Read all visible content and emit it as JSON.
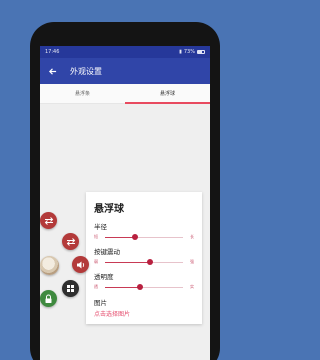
{
  "status": {
    "time": "17:46",
    "battery": "73%"
  },
  "appbar": {
    "title": "外观设置"
  },
  "tabs": [
    {
      "label": "悬浮条"
    },
    {
      "label": "悬浮球",
      "active": true
    }
  ],
  "card": {
    "title": "悬浮球",
    "sliders": [
      {
        "label": "半径",
        "min_label": "短",
        "max_label": "长",
        "value": 0.38
      },
      {
        "label": "按键震动",
        "min_label": "弱",
        "max_label": "强",
        "value": 0.58
      },
      {
        "label": "透明度",
        "min_label": "透",
        "max_label": "实",
        "value": 0.45
      }
    ],
    "image_label": "图片",
    "pick_image": "点击选择图片"
  },
  "icons": {
    "back": "arrow-back-icon",
    "transfer_1": "transfer-icon",
    "transfer_2": "transfer-icon",
    "volume": "volume-icon",
    "grid": "grid-icon",
    "lock": "lock-icon"
  },
  "colors": {
    "background": "#4a74b4",
    "appbar": "#3045a8",
    "accent": "#e84a5f",
    "slider": "#c83a55"
  }
}
